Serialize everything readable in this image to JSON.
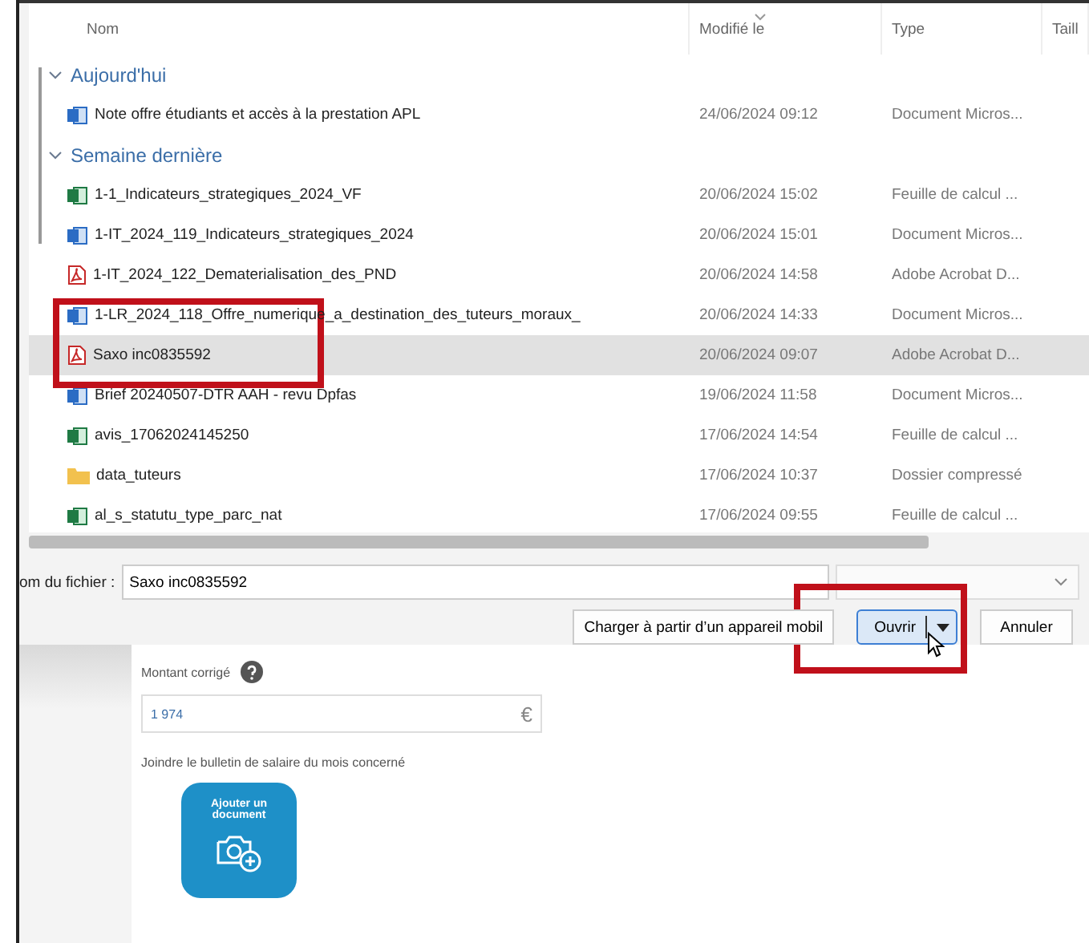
{
  "dialog": {
    "columns": [
      {
        "label": "Nom",
        "sorted": false
      },
      {
        "label": "Modifié le",
        "sorted": true
      },
      {
        "label": "Type",
        "sorted": false
      },
      {
        "label": "Taill",
        "sorted": false
      }
    ],
    "groups": [
      {
        "label": "Aujourd'hui",
        "expanded": true,
        "files": [
          {
            "name": "Note offre étudiants et accès à la prestation APL",
            "modified": "24/06/2024 09:12",
            "type": "Document Micros...",
            "kind": "word",
            "selected": false
          }
        ]
      },
      {
        "label": "Semaine dernière",
        "expanded": true,
        "files": [
          {
            "name": "1-1_Indicateurs_strategiques_2024_VF",
            "modified": "20/06/2024 15:02",
            "type": "Feuille de calcul ...",
            "kind": "excel",
            "selected": false
          },
          {
            "name": "1-IT_2024_119_Indicateurs_strategiques_2024",
            "modified": "20/06/2024 15:01",
            "type": "Document Micros...",
            "kind": "word",
            "selected": false
          },
          {
            "name": "1-IT_2024_122_Dematerialisation_des_PND",
            "modified": "20/06/2024 14:58",
            "type": "Adobe Acrobat D...",
            "kind": "pdf",
            "selected": false
          },
          {
            "name": "1-LR_2024_118_Offre_numerique_a_destination_des_tuteurs_moraux_",
            "modified": "20/06/2024 14:33",
            "type": "Document Micros...",
            "kind": "word",
            "selected": false
          },
          {
            "name": "Saxo inc0835592",
            "modified": "20/06/2024 09:07",
            "type": "Adobe Acrobat D...",
            "kind": "pdf",
            "selected": true
          },
          {
            "name": "Brief 20240507-DTR AAH - revu Dpfas",
            "modified": "19/06/2024 11:58",
            "type": "Document Micros...",
            "kind": "word",
            "selected": false
          },
          {
            "name": "avis_17062024145250",
            "modified": "17/06/2024 14:54",
            "type": "Feuille de calcul ...",
            "kind": "excel",
            "selected": false
          },
          {
            "name": "data_tuteurs",
            "modified": "17/06/2024 10:37",
            "type": "Dossier compressé",
            "kind": "folder",
            "selected": false
          },
          {
            "name": "al_s_statutu_type_parc_nat",
            "modified": "17/06/2024 09:55",
            "type": "Feuille de calcul ...",
            "kind": "excel",
            "selected": false
          }
        ]
      }
    ],
    "filename_label": "om du fichier :",
    "filename_value": "Saxo inc0835592",
    "buttons": [
      {
        "label": "Charger à partir d’un appareil mobil",
        "kind": "plain"
      },
      {
        "label": "Ouvrir",
        "kind": "split"
      },
      {
        "label": "Annuler",
        "kind": "plain"
      }
    ]
  },
  "page": {
    "amount_label": "Montant corrigé",
    "amount_value": "1 974",
    "currency": "€",
    "attach_label": "Joindre le bulletin de salaire du mois concerné",
    "upload_label": "Ajouter un document"
  }
}
